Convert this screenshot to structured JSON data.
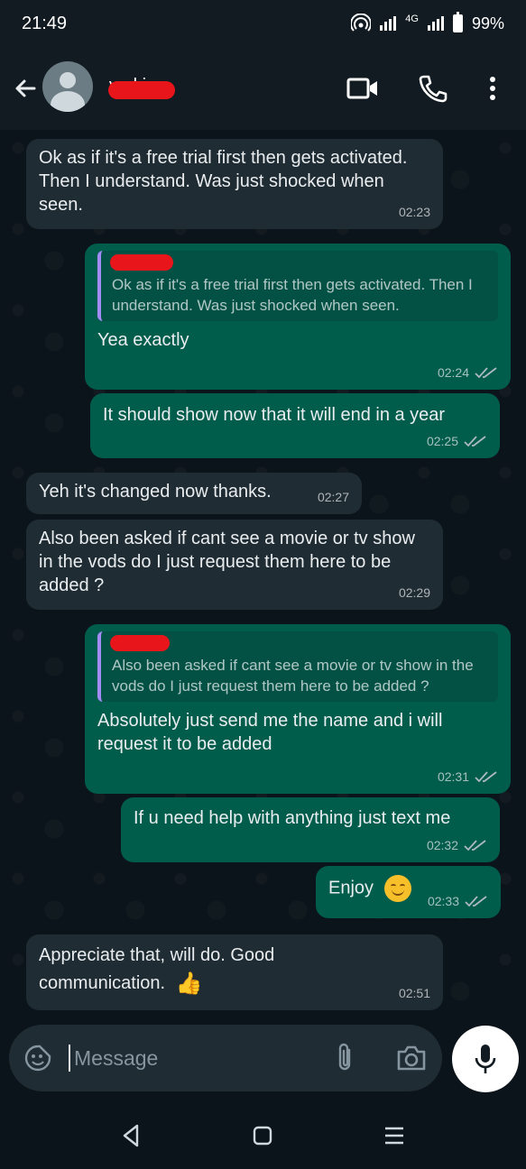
{
  "status_bar": {
    "time": "21:49",
    "network": "4G",
    "battery": "99%"
  },
  "header": {
    "contact_name": "v  nkie"
  },
  "messages": [
    {
      "direction": "in",
      "text": "Ok as if it's a free trial first then gets activated.  Then I understand. Was just shocked when seen.",
      "time": "02:23"
    },
    {
      "direction": "out",
      "quote": "Ok as if it's a free trial first then gets activated. Then I understand. Was just shocked when seen.",
      "text": "Yea exactly",
      "time": "02:24",
      "status": "read"
    },
    {
      "direction": "out",
      "text": "It should show now that it will end in a year",
      "time": "02:25",
      "status": "read"
    },
    {
      "direction": "in",
      "text": "Yeh it's changed now thanks.",
      "time": "02:27"
    },
    {
      "direction": "in",
      "text": "Also been asked if cant see a movie or tv show in the vods do I just request them here to be added ?",
      "time": "02:29"
    },
    {
      "direction": "out",
      "quote": "Also been asked if cant see a movie or tv show in the vods do I just request them here to be added ?",
      "text": "Absolutely just send me the name and i will request it to be added",
      "time": "02:31",
      "status": "read"
    },
    {
      "direction": "out",
      "text": "If u need help with anything just text me",
      "time": "02:32",
      "status": "read"
    },
    {
      "direction": "out",
      "text": "Enjoy",
      "emoji": "smiling-face-icon",
      "time": "02:33",
      "status": "read"
    },
    {
      "direction": "in",
      "text": "Appreciate that, will do. Good communication.",
      "emoji": "thumbs-up-icon",
      "time": "02:51"
    }
  ],
  "composer": {
    "placeholder": "Message"
  },
  "colors": {
    "incoming_bubble": "#202c33",
    "outgoing_bubble": "#005c4b",
    "background": "#0b141a",
    "quote_bar": "#a38cf5",
    "redaction": "#e8151b"
  }
}
